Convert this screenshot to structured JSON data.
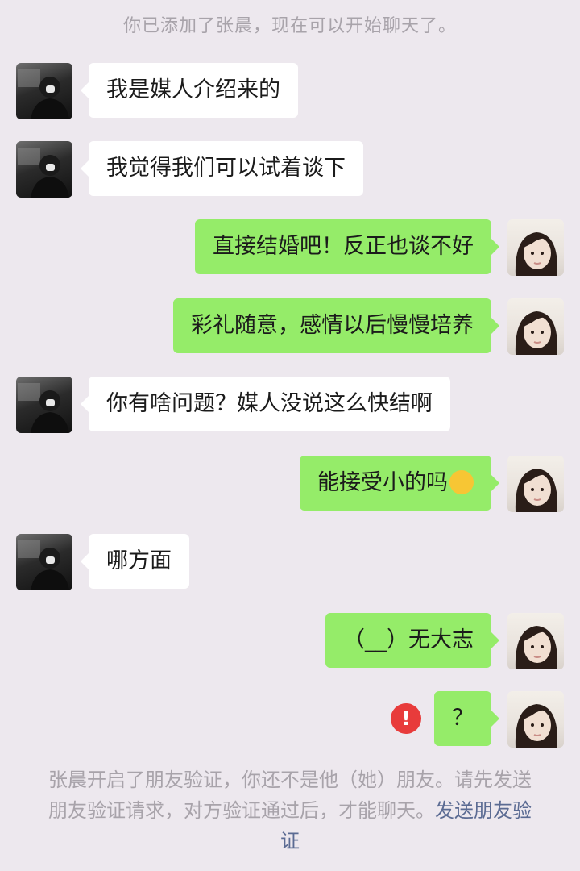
{
  "system_top": "你已添加了张晨，现在可以开始聊天了。",
  "messages": [
    {
      "sender": "them",
      "text": "我是媒人介绍来的"
    },
    {
      "sender": "them",
      "text": "我觉得我们可以试着谈下"
    },
    {
      "sender": "me",
      "text": "直接结婚吧！反正也谈不好"
    },
    {
      "sender": "me",
      "text": "彩礼随意，感情以后慢慢培养"
    },
    {
      "sender": "them",
      "text": "你有啥问题？媒人没说这么快结啊"
    },
    {
      "sender": "me",
      "text": "能接受小的吗",
      "emoji": "laughing-crying-emoji"
    },
    {
      "sender": "them",
      "text": "哪方面"
    },
    {
      "sender": "me",
      "text": "（__）无大志"
    },
    {
      "sender": "me",
      "text": "？",
      "status": "failed"
    }
  ],
  "failed_icon_text": "!",
  "system_bottom": {
    "text": "张晨开启了朋友验证，你还不是他（她）朋友。请先发送朋友验证请求，对方验证通过后，才能聊天。",
    "link": "发送朋友验证"
  },
  "colors": {
    "background": "#ede8ee",
    "bubble_me": "#95ec69",
    "bubble_them": "#ffffff",
    "system_text": "#a8a3aa",
    "link": "#5b6b93",
    "failed": "#e83b3b"
  }
}
